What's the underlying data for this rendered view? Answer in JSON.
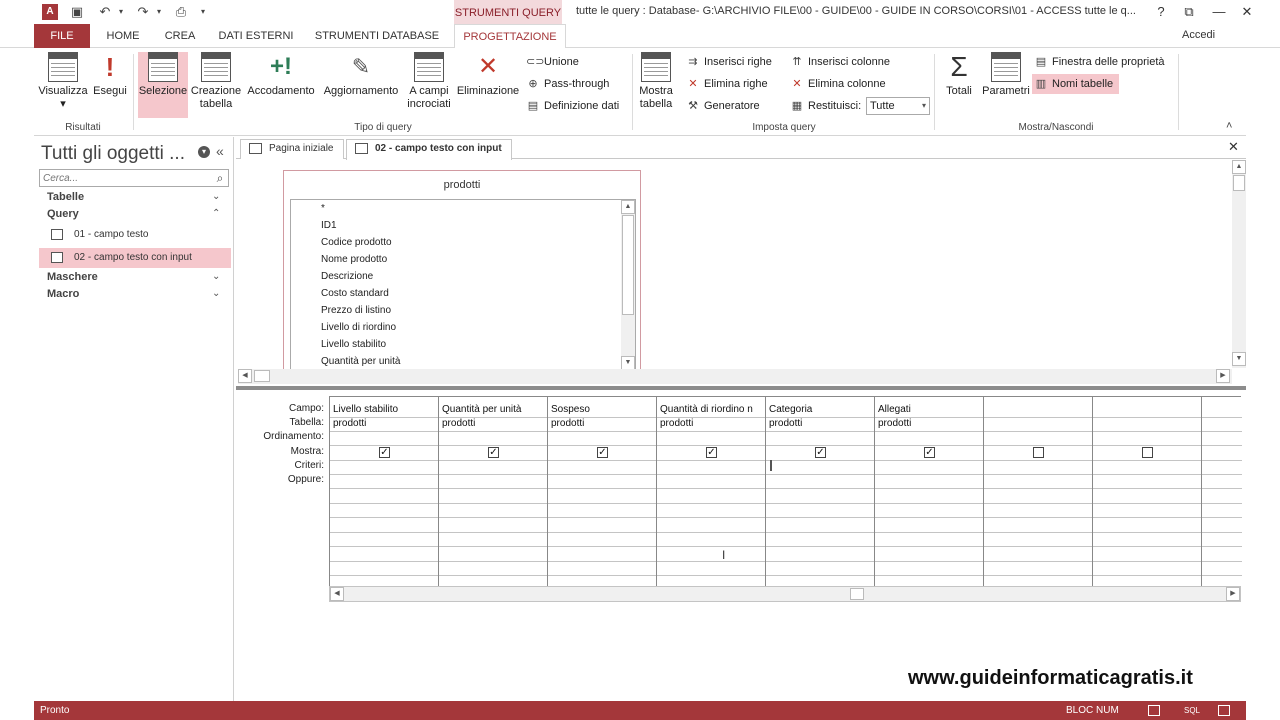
{
  "titlebar": {
    "context_tab": "STRUMENTI QUERY",
    "title": "tutte le query : Database- G:\\ARCHIVIO FILE\\00 - GUIDE\\00 - GUIDE IN CORSO\\CORSI\\01 - ACCESS tutte le q...",
    "help": "?",
    "restore": "⧉",
    "minimize": "—",
    "maximize": "❐",
    "close": "✕"
  },
  "tabs": {
    "file": "FILE",
    "home": "HOME",
    "crea": "CREA",
    "dati_esterni": "DATI ESTERNI",
    "strumenti_database": "STRUMENTI DATABASE",
    "progettazione": "PROGETTAZIONE",
    "accedi": "Accedi"
  },
  "ribbon": {
    "visualizza": "Visualizza",
    "visualizza_arrow": "▾",
    "esegui": "Esegui",
    "risultati_label": "Risultati",
    "selezione": "Selezione",
    "creazione_tabella_1": "Creazione",
    "creazione_tabella_2": "tabella",
    "accodamento": "Accodamento",
    "aggiornamento": "Aggiornamento",
    "a_campi_1": "A campi",
    "a_campi_2": "incrociati",
    "eliminazione": "Eliminazione",
    "unione": "Unione",
    "pass_through": "Pass-through",
    "definizione_dati": "Definizione dati",
    "tipo_query_label": "Tipo di query",
    "mostra_tabella_1": "Mostra",
    "mostra_tabella_2": "tabella",
    "inserisci_righe": "Inserisci righe",
    "elimina_righe": "Elimina righe",
    "generatore": "Generatore",
    "inserisci_colonne": "Inserisci colonne",
    "elimina_colonne": "Elimina colonne",
    "restituisci": "Restituisci:",
    "restituisci_value": "Tutte",
    "imposta_query_label": "Imposta query",
    "totali": "Totali",
    "parametri": "Parametri",
    "finestra_proprieta": "Finestra delle proprietà",
    "nomi_tabelle": "Nomi tabelle",
    "mostra_nascondi_label": "Mostra/Nascondi",
    "collapse": "˄"
  },
  "nav": {
    "title": "Tutti gli oggetti ...",
    "search_placeholder": "Cerca...",
    "collapse_btn": "«",
    "sections": {
      "tabelle": "Tabelle",
      "query": "Query",
      "maschere": "Maschere",
      "macro": "Macro"
    },
    "chev_down": "¥",
    "chev_up": "˄",
    "items": [
      {
        "label": "01 - campo testo"
      },
      {
        "label": "02 - campo testo con input"
      }
    ]
  },
  "doc_tabs": [
    {
      "label": "Pagina iniziale"
    },
    {
      "label": "02 - campo testo con input"
    }
  ],
  "doc_close": "✕",
  "table_box": {
    "title": "prodotti",
    "fields": [
      "*",
      "ID1",
      "Codice prodotto",
      "Nome prodotto",
      "Descrizione",
      "Costo standard",
      "Prezzo di listino",
      "Livello di riordino",
      "Livello stabilito",
      "Quantità per unità"
    ]
  },
  "grid": {
    "row_labels": [
      "Campo:",
      "Tabella:",
      "Ordinamento:",
      "Mostra:",
      "Criteri:",
      "Oppure:"
    ],
    "columns": [
      {
        "campo": "Livello stabilito",
        "tabella": "prodotti",
        "mostra": true
      },
      {
        "campo": "Quantità per unità",
        "tabella": "prodotti",
        "mostra": true
      },
      {
        "campo": "Sospeso",
        "tabella": "prodotti",
        "mostra": true
      },
      {
        "campo": "Quantità di riordino n",
        "tabella": "prodotti",
        "mostra": true
      },
      {
        "campo": "Categoria",
        "tabella": "prodotti",
        "mostra": true
      },
      {
        "campo": "Allegati",
        "tabella": "prodotti",
        "mostra": true
      },
      {
        "campo": "",
        "tabella": "",
        "mostra": false
      },
      {
        "campo": "",
        "tabella": "",
        "mostra": false
      }
    ],
    "check_mark": "✓"
  },
  "status": {
    "left": "Pronto",
    "bloc_num": "BLOC NUM",
    "sql": "SQL"
  },
  "watermark": "www.guideinformaticagratis.it",
  "colors": {
    "accent": "#a4373a",
    "selected": "#f5c7cc"
  }
}
